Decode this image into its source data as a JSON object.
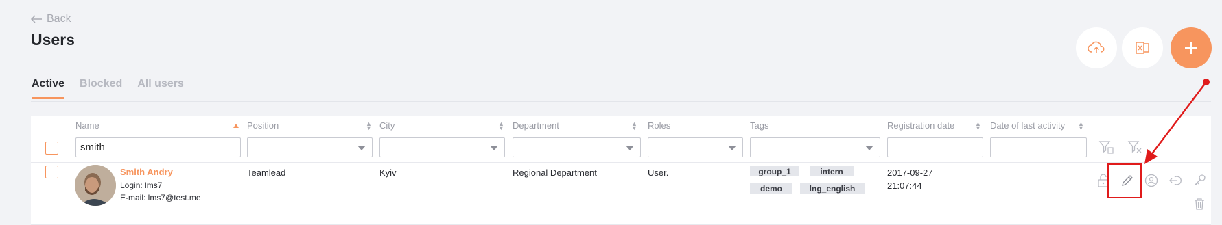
{
  "header": {
    "back_label": "Back",
    "title": "Users"
  },
  "actions": {
    "upload_icon": "cloud-upload-icon",
    "export_icon": "excel-export-icon",
    "add_icon": "plus-icon",
    "accent_color": "#f7955e"
  },
  "tabs": [
    {
      "label": "Active",
      "active": true
    },
    {
      "label": "Blocked",
      "active": false
    },
    {
      "label": "All users",
      "active": false
    }
  ],
  "columns": {
    "name": "Name",
    "position": "Position",
    "city": "City",
    "department": "Department",
    "roles": "Roles",
    "tags": "Tags",
    "registration_date": "Registration date",
    "last_activity": "Date of last activity"
  },
  "filters": {
    "name_value": "smith",
    "position_value": "",
    "city_value": "",
    "department_value": "",
    "roles_value": "",
    "tags_value": "",
    "registration_value": "",
    "activity_value": ""
  },
  "rows": [
    {
      "name": "Smith Andry",
      "login": "Login: lms7",
      "email": "E-mail: lms7@test.me",
      "position": "Teamlead",
      "city": "Kyiv",
      "department": "Regional Department",
      "roles": "User.",
      "tags": [
        "group_1",
        "intern",
        "demo",
        "lng_english"
      ],
      "registration_date": "2017-09-27",
      "registration_time": "21:07:44",
      "actions": [
        "unlock-icon",
        "edit-pencil-icon",
        "user-circle-icon",
        "login-as-icon",
        "key-icon",
        "trash-icon"
      ]
    }
  ]
}
